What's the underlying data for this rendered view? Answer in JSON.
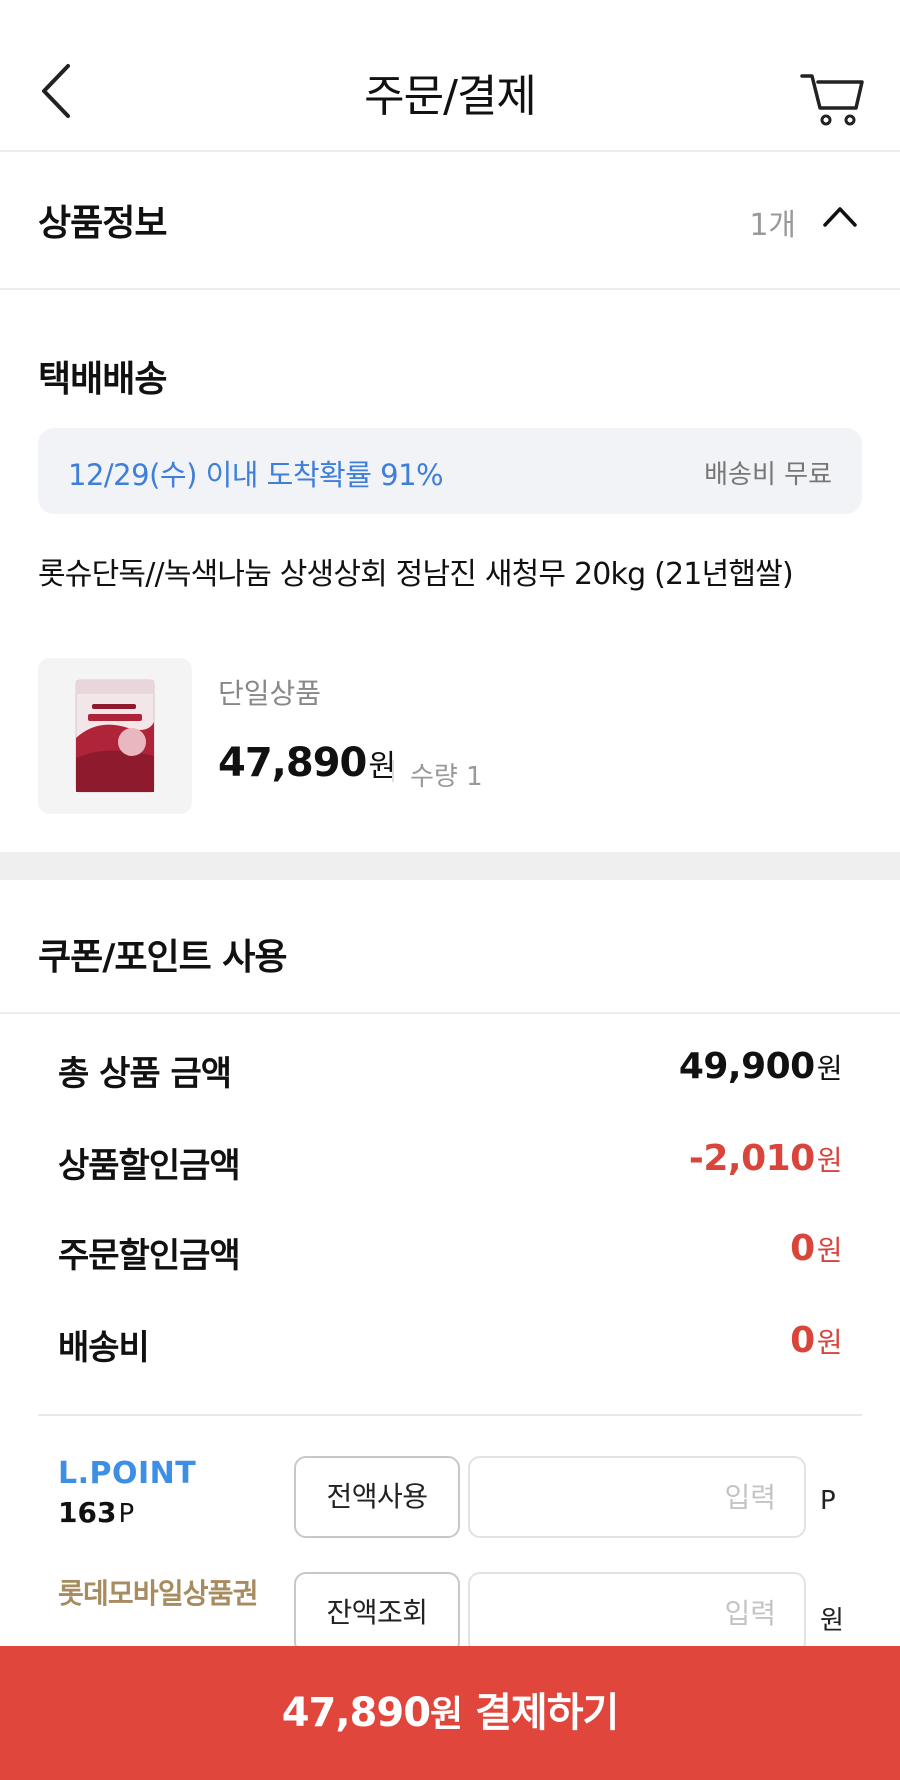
{
  "header": {
    "title": "주문/결제"
  },
  "product_info": {
    "title": "상품정보",
    "count": "1개"
  },
  "delivery": {
    "section_title": "택배배송",
    "eta": "12/29(수) 이내 도착확률 91%",
    "fee": "배송비 무료",
    "product_name": "롯슈단독//녹색나눔 상생상회 정남진 새청무 20kg (21년햅쌀)",
    "option": "단일상품",
    "price": "47,890",
    "price_unit": "원",
    "quantity": "수량 1"
  },
  "coupon": {
    "section_title": "쿠폰/포인트 사용"
  },
  "summary": [
    {
      "label": "총 상품 금액",
      "value": "49,900",
      "unit": "원"
    },
    {
      "label": "상품할인금액",
      "value": "-2,010",
      "unit": "원"
    },
    {
      "label": "주문할인금액",
      "value": "0",
      "unit": "원"
    },
    {
      "label": "배송비",
      "value": "0",
      "unit": "원"
    }
  ],
  "lpoint": {
    "brand": "L.POINT",
    "balance": "163",
    "balance_unit": "P",
    "button": "전액사용",
    "placeholder": "입력",
    "unit": "P"
  },
  "giftcard": {
    "brand": "롯데모바일상품권",
    "button": "잔액조회",
    "placeholder": "입력",
    "unit": "원"
  },
  "pay": {
    "amount": "47,890",
    "unit": "원",
    "label": "결제하기"
  },
  "colors": {
    "accent_red": "#e0463c",
    "discount_red": "#d9453b",
    "eta_blue": "#3d7fd9",
    "lpoint_blue": "#3d8fe6",
    "giftcard_gold": "#a68c5f"
  },
  "icons": {
    "back": "chevron-left-icon",
    "cart": "cart-icon",
    "collapse": "chevron-up-icon"
  }
}
